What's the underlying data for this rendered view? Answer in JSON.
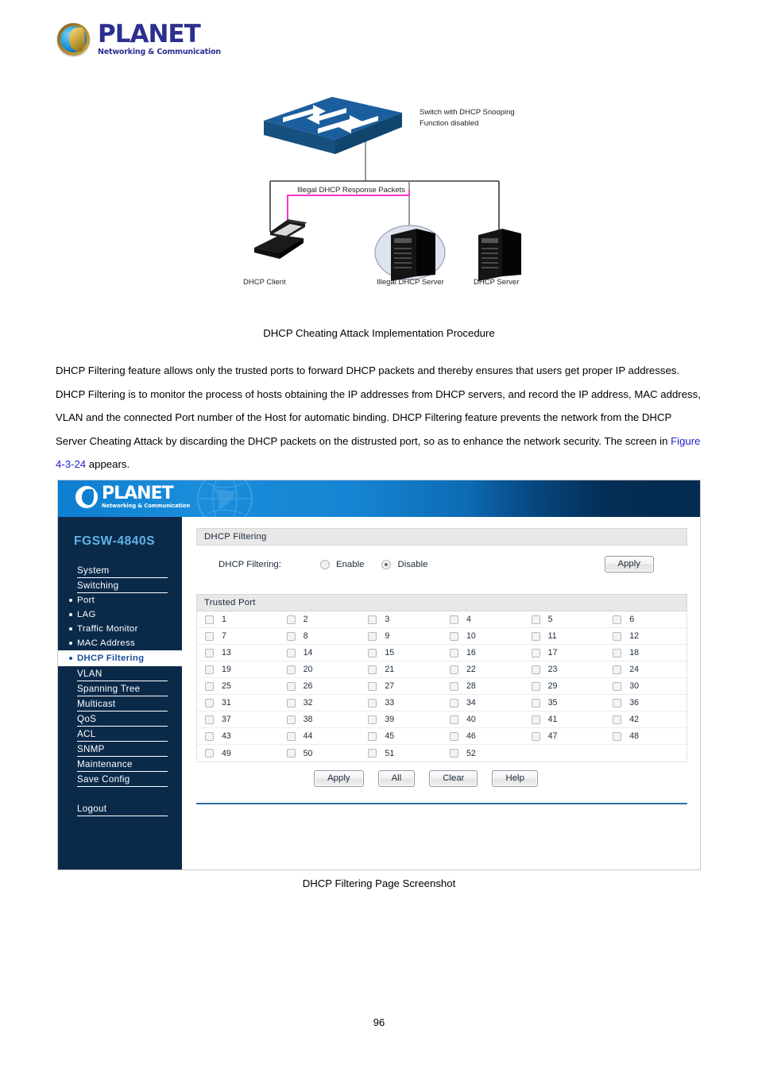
{
  "document": {
    "brand": {
      "name": "PLANET",
      "tagline": "Networking & Communication"
    },
    "page_number": "96",
    "figure_caption_diagram": "DHCP Cheating Attack Implementation Procedure",
    "figure_caption_ui": "DHCP Filtering Page Screenshot",
    "paragraph": {
      "part1": "DHCP Filtering feature allows only the trusted ports to forward DHCP packets and thereby ensures that users get proper IP addresses. DHCP Filtering is to monitor the process of hosts obtaining the IP addresses from DHCP servers, and record the IP address, MAC address, VLAN and the connected Port number of the Host for automatic binding. DHCP Filtering feature prevents the network from the DHCP Server Cheating Attack by discarding the DHCP packets on the distrusted port, so as to enhance the network security. The screen in ",
      "link": "Figure 4-3-24",
      "part2": " appears."
    }
  },
  "diagram": {
    "switch_label_line1": "Switch with DHCP Snooping",
    "switch_label_line2": "Function disabled",
    "packet_label": "Illegal DHCP Response Packets",
    "node_client": "DHCP Client",
    "node_illegal_server": "Illegal DHCP Server",
    "node_server": "DHCP Server",
    "arrow_color": "#ff33cc",
    "switch_color": "#1b5e9e"
  },
  "switch_ui": {
    "brand": {
      "name": "PLANET",
      "tagline": "Networking & Communication"
    },
    "model": "FGSW-4840S",
    "tab": "DHCP Filtering",
    "sidebar": {
      "items": [
        {
          "label": "System",
          "type": "group",
          "active": false
        },
        {
          "label": "Switching",
          "type": "group",
          "active": false
        },
        {
          "label": "Port",
          "type": "sub",
          "active": false
        },
        {
          "label": "LAG",
          "type": "sub",
          "active": false
        },
        {
          "label": "Traffic Monitor",
          "type": "sub",
          "active": false
        },
        {
          "label": "MAC Address",
          "type": "sub",
          "active": false
        },
        {
          "label": "DHCP Filtering",
          "type": "sub",
          "active": true
        },
        {
          "label": "VLAN",
          "type": "group",
          "active": false
        },
        {
          "label": "Spanning Tree",
          "type": "group",
          "active": false
        },
        {
          "label": "Multicast",
          "type": "group",
          "active": false
        },
        {
          "label": "QoS",
          "type": "group",
          "active": false
        },
        {
          "label": "ACL",
          "type": "group",
          "active": false
        },
        {
          "label": "SNMP",
          "type": "group",
          "active": false
        },
        {
          "label": "Maintenance",
          "type": "group",
          "active": false
        },
        {
          "label": "Save Config",
          "type": "group",
          "active": false
        }
      ],
      "logout": "Logout"
    },
    "filter_panel": {
      "header": "DHCP Filtering",
      "field_label": "DHCP Filtering:",
      "options": [
        {
          "label": "Enable",
          "selected": false
        },
        {
          "label": "Disable",
          "selected": true
        }
      ],
      "apply_label": "Apply"
    },
    "trusted_port_panel": {
      "header": "Trusted Port",
      "ports": [
        {
          "number": "1",
          "checked": false
        },
        {
          "number": "2",
          "checked": false
        },
        {
          "number": "3",
          "checked": false
        },
        {
          "number": "4",
          "checked": false
        },
        {
          "number": "5",
          "checked": false
        },
        {
          "number": "6",
          "checked": false
        },
        {
          "number": "7",
          "checked": false
        },
        {
          "number": "8",
          "checked": false
        },
        {
          "number": "9",
          "checked": false
        },
        {
          "number": "10",
          "checked": false
        },
        {
          "number": "11",
          "checked": false
        },
        {
          "number": "12",
          "checked": false
        },
        {
          "number": "13",
          "checked": false
        },
        {
          "number": "14",
          "checked": false
        },
        {
          "number": "15",
          "checked": false
        },
        {
          "number": "16",
          "checked": false
        },
        {
          "number": "17",
          "checked": false
        },
        {
          "number": "18",
          "checked": false
        },
        {
          "number": "19",
          "checked": false
        },
        {
          "number": "20",
          "checked": false
        },
        {
          "number": "21",
          "checked": false
        },
        {
          "number": "22",
          "checked": false
        },
        {
          "number": "23",
          "checked": false
        },
        {
          "number": "24",
          "checked": false
        },
        {
          "number": "25",
          "checked": false
        },
        {
          "number": "26",
          "checked": false
        },
        {
          "number": "27",
          "checked": false
        },
        {
          "number": "28",
          "checked": false
        },
        {
          "number": "29",
          "checked": false
        },
        {
          "number": "30",
          "checked": false
        },
        {
          "number": "31",
          "checked": false
        },
        {
          "number": "32",
          "checked": false
        },
        {
          "number": "33",
          "checked": false
        },
        {
          "number": "34",
          "checked": false
        },
        {
          "number": "35",
          "checked": false
        },
        {
          "number": "36",
          "checked": false
        },
        {
          "number": "37",
          "checked": false
        },
        {
          "number": "38",
          "checked": false
        },
        {
          "number": "39",
          "checked": false
        },
        {
          "number": "40",
          "checked": false
        },
        {
          "number": "41",
          "checked": false
        },
        {
          "number": "42",
          "checked": false
        },
        {
          "number": "43",
          "checked": false
        },
        {
          "number": "44",
          "checked": false
        },
        {
          "number": "45",
          "checked": false
        },
        {
          "number": "46",
          "checked": false
        },
        {
          "number": "47",
          "checked": false
        },
        {
          "number": "48",
          "checked": false
        },
        {
          "number": "49",
          "checked": false
        },
        {
          "number": "50",
          "checked": false
        },
        {
          "number": "51",
          "checked": false
        },
        {
          "number": "52",
          "checked": false
        }
      ],
      "columns": 6,
      "buttons": [
        "Apply",
        "All",
        "Clear",
        "Help"
      ]
    }
  }
}
